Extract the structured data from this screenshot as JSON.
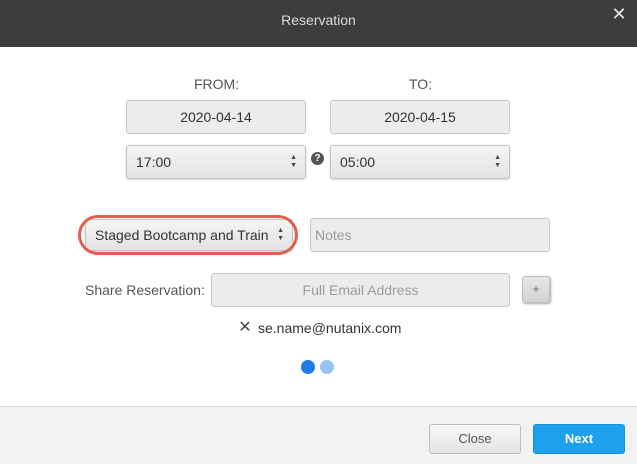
{
  "header": {
    "title": "Reservation"
  },
  "labels": {
    "from": "FROM:",
    "to": "TO:",
    "share": "Share Reservation:"
  },
  "from": {
    "date": "2020-04-14",
    "time": "17:00"
  },
  "to": {
    "date": "2020-04-15",
    "time": "05:00"
  },
  "help_icon_glyph": "?",
  "reservation_type": {
    "selected": "Staged Bootcamp and Train"
  },
  "notes": {
    "placeholder": "Notes"
  },
  "share": {
    "email_placeholder": "Full Email Address",
    "add_label": "+",
    "shared_with": [
      "se.name@nutanix.com"
    ]
  },
  "pagination": {
    "total": 2,
    "current": 1
  },
  "footer": {
    "close_label": "Close",
    "next_label": "Next"
  },
  "colors": {
    "header_bg": "#3d3d3d",
    "accent": "#1da1ec",
    "dot_active": "#1f7be6",
    "dot_inactive": "#98c2f2",
    "highlight": "#e06050"
  }
}
